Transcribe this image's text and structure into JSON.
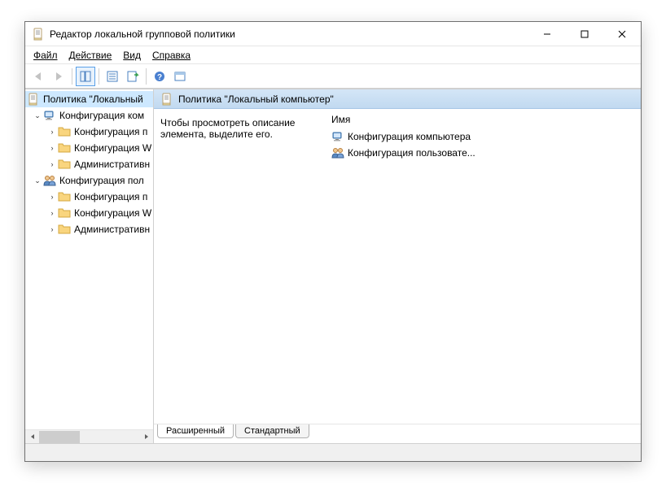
{
  "window": {
    "title": "Редактор локальной групповой политики"
  },
  "menu": {
    "file": "Файл",
    "action": "Действие",
    "view": "Вид",
    "help": "Справка"
  },
  "tree": {
    "root": "Политика \"Локальный",
    "compConfig": "Конфигурация ком",
    "compSoftware": "Конфигурация п",
    "compWindows": "Конфигурация W",
    "compAdmin": "Административн",
    "userConfig": "Конфигурация пол",
    "userSoftware": "Конфигурация п",
    "userWindows": "Конфигурация W",
    "userAdmin": "Административн"
  },
  "main": {
    "headerTitle": "Политика \"Локальный компьютер\"",
    "description": "Чтобы просмотреть описание элемента, выделите его.",
    "columnName": "Имя",
    "items": {
      "comp": "Конфигурация компьютера",
      "user": "Конфигурация пользовате..."
    }
  },
  "tabs": {
    "extended": "Расширенный",
    "standard": "Стандартный"
  }
}
